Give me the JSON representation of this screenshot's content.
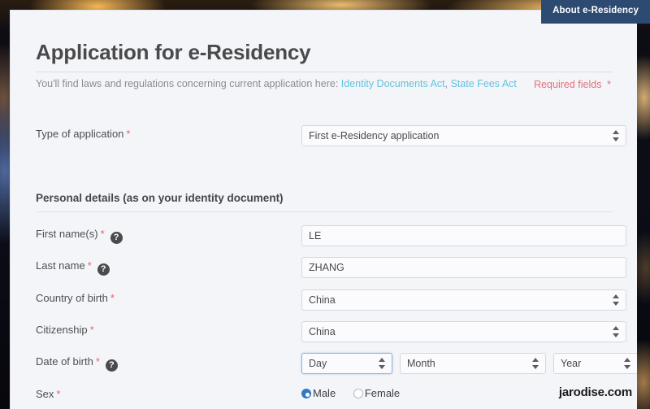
{
  "nav": {
    "about_tab_label": "About e-Residency"
  },
  "header": {
    "title": "Application for e-Residency",
    "subtitle_prefix": "You'll find laws and regulations concerning current application here:",
    "link_identity_documents_act": "Identity Documents Act",
    "link_separator": ",",
    "link_state_fees_act": "State Fees Act",
    "required_fields_label": "Required fields",
    "required_star": "*"
  },
  "form": {
    "type_of_application": {
      "label": "Type of application",
      "star": "*",
      "value": "First e-Residency application"
    },
    "section_personal_details": "Personal details (as on your identity document)",
    "first_name": {
      "label": "First name(s)",
      "star": "*",
      "help_glyph": "?",
      "value": "LE"
    },
    "last_name": {
      "label": "Last name",
      "star": "*",
      "help_glyph": "?",
      "value": "ZHANG"
    },
    "country_of_birth": {
      "label": "Country of birth",
      "star": "*",
      "value": "China"
    },
    "citizenship": {
      "label": "Citizenship",
      "star": "*",
      "value": "China"
    },
    "date_of_birth": {
      "label": "Date of birth",
      "star": "*",
      "help_glyph": "?",
      "day_value": "Day",
      "month_value": "Month",
      "year_value": "Year"
    },
    "sex": {
      "label": "Sex",
      "star": "*",
      "male_label": "Male",
      "female_label": "Female",
      "selected": "Male"
    }
  },
  "watermark": {
    "text": "jarodise.com"
  },
  "colors": {
    "accent_nav": "#2d4a72",
    "link": "#63c2dd",
    "required_red": "#e4717a",
    "radio_selected": "#2f79c4",
    "page_bg": "#f4f5f9"
  }
}
